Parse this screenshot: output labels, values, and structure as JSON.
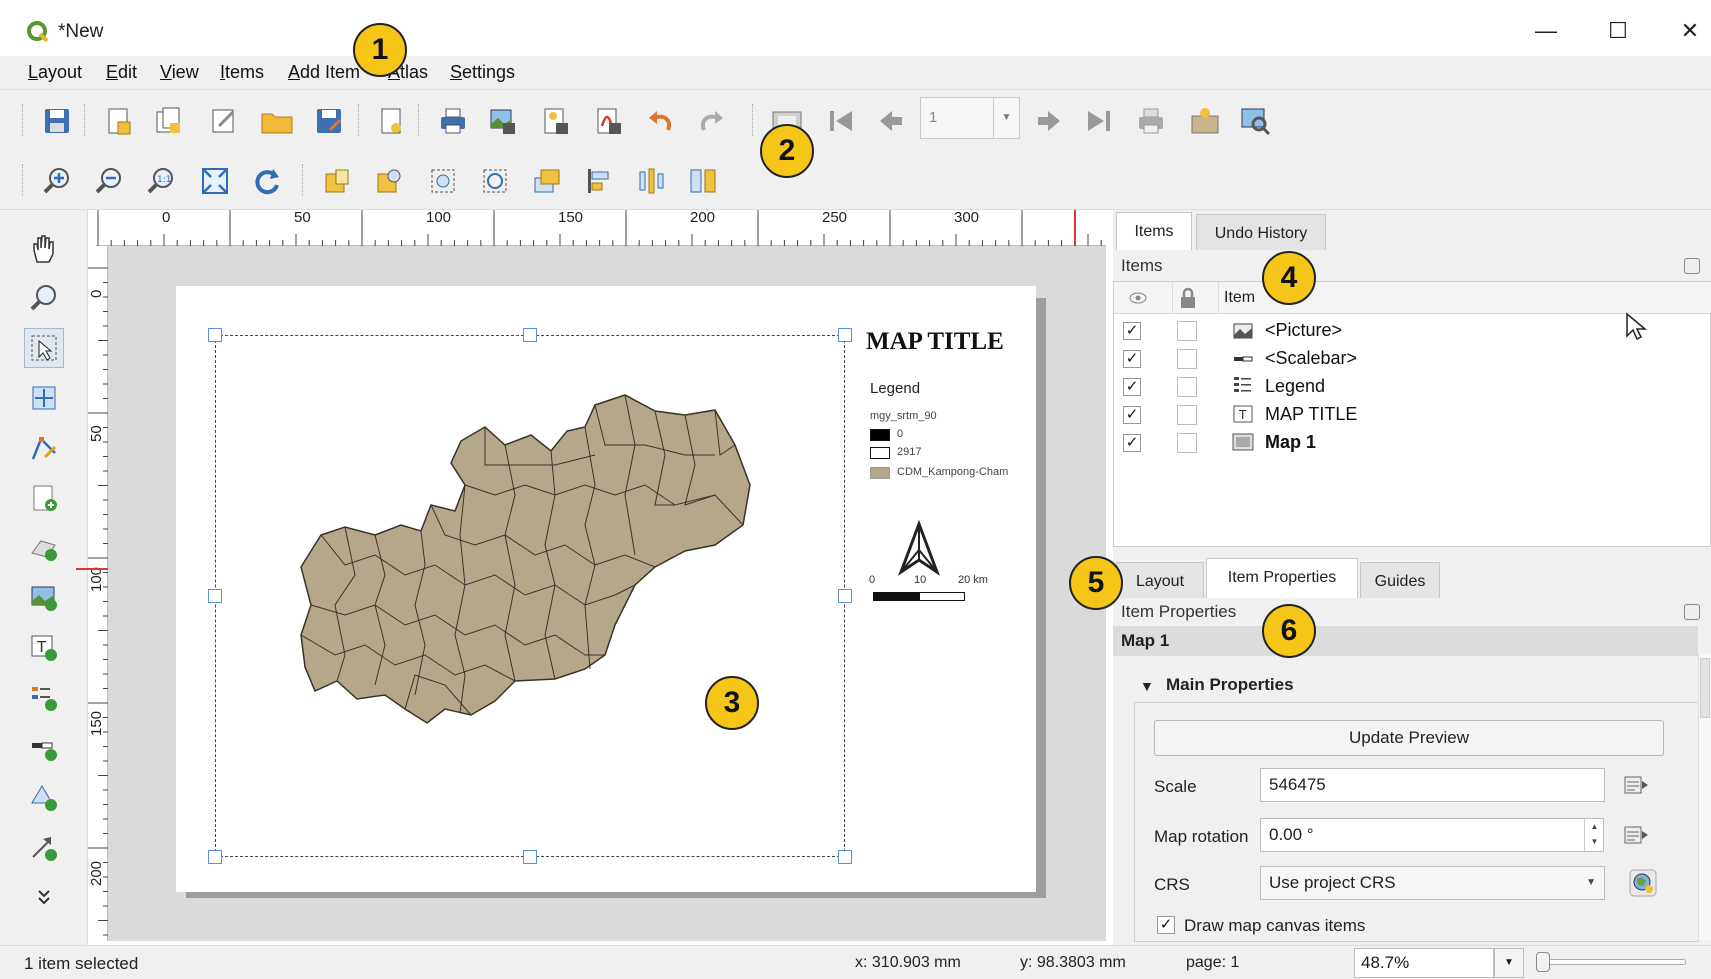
{
  "window": {
    "title": "*New",
    "minimize_glyph": "—",
    "maximize_glyph": "☐",
    "close_glyph": "✕"
  },
  "menu": [
    {
      "underline": "L",
      "rest": "ayout"
    },
    {
      "underline": "E",
      "rest": "dit"
    },
    {
      "underline": "V",
      "rest": "iew"
    },
    {
      "underline": "I",
      "rest": "tems"
    },
    {
      "underline": "A",
      "rest": "dd Item"
    },
    {
      "underline": "A",
      "rest": "tlas"
    },
    {
      "underline": "S",
      "rest": "ettings"
    }
  ],
  "atlas_toolbar": {
    "page_value": "1"
  },
  "ruler": {
    "horizontal": [
      "0",
      "50",
      "100",
      "150",
      "200",
      "250",
      "300"
    ],
    "vertical": [
      "0",
      "50",
      "100",
      "150",
      "200"
    ]
  },
  "layout": {
    "map_title": "MAP TITLE",
    "legend": {
      "title": "Legend",
      "layer": "mgy_srtm_90",
      "entries": [
        {
          "label": "0",
          "color": "#000000"
        },
        {
          "label": "2917",
          "color": "#ffffff"
        },
        {
          "label": "CDM_Kampong-Cham",
          "color": "#b4a78a"
        }
      ]
    },
    "scalebar": {
      "labels": [
        "0",
        "10",
        "20 km"
      ]
    },
    "map_fill_color": "#b4a78a",
    "map_stroke_color": "#3a3327"
  },
  "items_panel": {
    "tabs": [
      "Items",
      "Undo History"
    ],
    "active_tab": "Items",
    "title": "Items",
    "column_item": "Item",
    "rows": [
      {
        "label": "<Picture>",
        "visible": "✓",
        "icon": "picture-icon",
        "bold": false
      },
      {
        "label": "<Scalebar>",
        "visible": "✓",
        "icon": "scalebar-icon",
        "bold": false
      },
      {
        "label": "Legend",
        "visible": "✓",
        "icon": "legend-icon",
        "bold": false
      },
      {
        "label": "MAP TITLE",
        "visible": "✓",
        "icon": "label-icon",
        "bold": false
      },
      {
        "label": "Map 1",
        "visible": "✓",
        "icon": "map-icon",
        "bold": true
      }
    ]
  },
  "properties_panel": {
    "tabs": [
      "Layout",
      "Item Properties",
      "Guides"
    ],
    "active_tab": "Item Properties",
    "title": "Item Properties",
    "selected_item": "Map 1",
    "group_title": "Main Properties",
    "update_preview": "Update Preview",
    "scale_label": "Scale",
    "scale_value": "546475",
    "rotation_label": "Map rotation",
    "rotation_value": "0.00 °",
    "crs_label": "CRS",
    "crs_value": "Use project CRS",
    "draw_items_label": "Draw map canvas items",
    "draw_items_checked": "✓"
  },
  "statusbar": {
    "selection": "1 item selected",
    "x": "x: 310.903 mm",
    "y": "y: 98.3803 mm",
    "page": "page: 1",
    "zoom": "48.7%"
  },
  "callouts": [
    "1",
    "2",
    "3",
    "4",
    "5",
    "6"
  ],
  "colors": {
    "callout": "#f5c518",
    "logo_green": "#589632",
    "icon_blue": "#2f6db5",
    "icon_orange": "#e0762a"
  }
}
